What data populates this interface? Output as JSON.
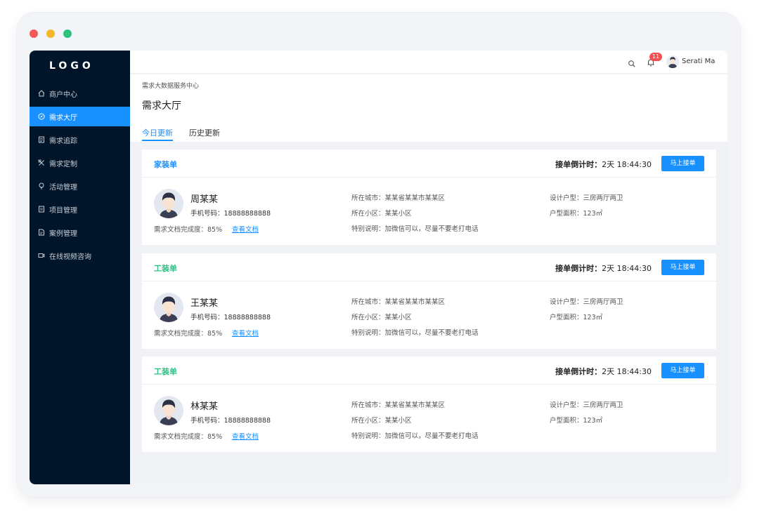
{
  "sidebar": {
    "logo": "LOGO",
    "items": [
      {
        "label": "商户中心",
        "icon": "home-icon",
        "active": false
      },
      {
        "label": "需求大厅",
        "icon": "compass-icon",
        "active": true
      },
      {
        "label": "需求追踪",
        "icon": "doc-icon",
        "active": false
      },
      {
        "label": "需求定制",
        "icon": "tools-icon",
        "active": false
      },
      {
        "label": "活动管理",
        "icon": "bulb-icon",
        "active": false
      },
      {
        "label": "项目管理",
        "icon": "book-icon",
        "active": false
      },
      {
        "label": "案例管理",
        "icon": "file-icon",
        "active": false
      },
      {
        "label": "在线视频咨询",
        "icon": "video-icon",
        "active": false
      }
    ]
  },
  "header": {
    "notification_count": "11",
    "username": "Serati Ma",
    "icons": [
      "search-icon",
      "bell-icon",
      "avatar"
    ]
  },
  "page": {
    "breadcrumb": "需求大数据服务中心",
    "title": "需求大厅",
    "tabs": [
      {
        "label": "今日更新",
        "active": true
      },
      {
        "label": "历史更新",
        "active": false
      }
    ]
  },
  "labels": {
    "countdown_prefix": "接单倒计时：",
    "accept_button": "马上接单",
    "phone_prefix": "手机号码：",
    "progress_prefix": "需求文档完成度：",
    "view_doc": "查看文档",
    "city_prefix": "所在城市：",
    "community_prefix": "所在小区：",
    "note_prefix": "特别说明：",
    "layout_prefix": "设计户型：",
    "area_prefix": "户型面积："
  },
  "cards": [
    {
      "type": "家装单",
      "type_color": "#1890ff",
      "countdown": "2天 18:44:30",
      "name": "周某某",
      "phone": "18888888888",
      "progress": "85%",
      "city": "某某省某某市某某区",
      "community": "某某小区",
      "note": "加微信可以，尽量不要老打电话",
      "layout": "三房两厅两卫",
      "area": "123㎡"
    },
    {
      "type": "工装单",
      "type_color": "#2ebf84",
      "countdown": "2天 18:44:30",
      "name": "王某某",
      "phone": "18888888888",
      "progress": "85%",
      "city": "某某省某某市某某区",
      "community": "某某小区",
      "note": "加微信可以，尽量不要老打电话",
      "layout": "三房两厅两卫",
      "area": "123㎡"
    },
    {
      "type": "工装单",
      "type_color": "#2ebf84",
      "countdown": "2天 18:44:30",
      "name": "林某某",
      "phone": "18888888888",
      "progress": "85%",
      "city": "某某省某某市某某区",
      "community": "某某小区",
      "note": "加微信可以，尽量不要老打电话",
      "layout": "三房两厅两卫",
      "area": "123㎡"
    }
  ],
  "colors": {
    "sidebar_bg": "#001529",
    "primary": "#1890ff",
    "home_card_type": "#1890ff",
    "tooling_card_type": "#2ebf84",
    "badge": "#f5504f"
  }
}
